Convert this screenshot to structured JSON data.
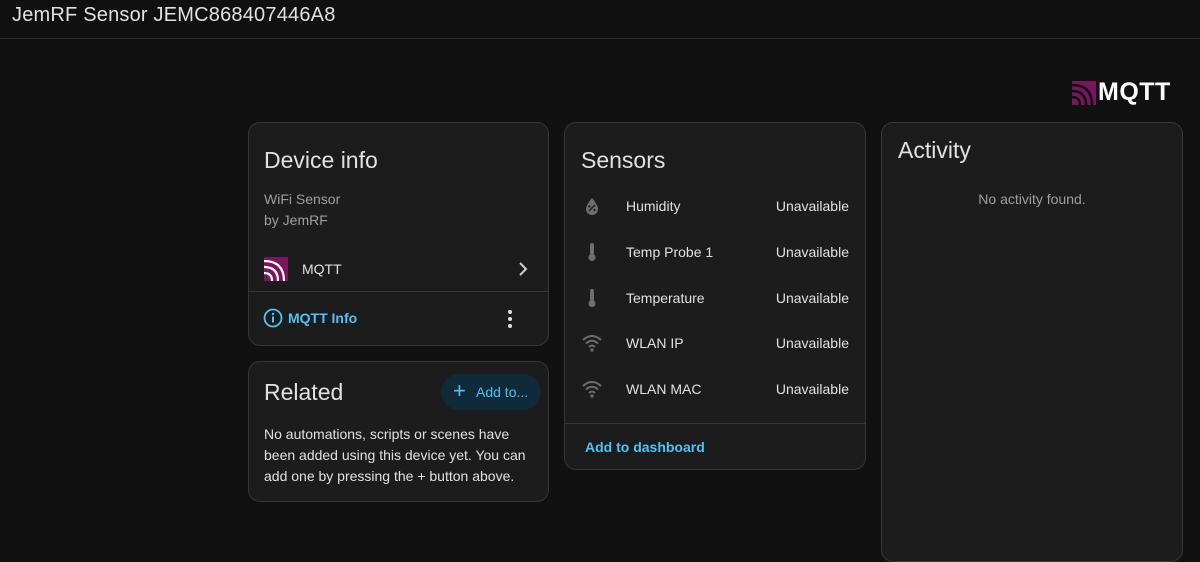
{
  "page": {
    "title": "JemRF Sensor JEMC868407446A8"
  },
  "brand": {
    "name": "MQTT",
    "accent": "#8c1a6a"
  },
  "device_info": {
    "heading": "Device info",
    "model": "WiFi Sensor",
    "manufacturer": "by JemRF",
    "integration": {
      "label": "MQTT",
      "icon": "mqtt-icon"
    },
    "action_label": "MQTT Info"
  },
  "related": {
    "heading": "Related",
    "add_label": "Add to...",
    "message": "No automations, scripts or scenes have been added using this device yet. You can add one by pressing the + button above."
  },
  "sensors": {
    "heading": "Sensors",
    "items": [
      {
        "name": "Humidity",
        "value": "Unavailable",
        "icon": "humidity-icon"
      },
      {
        "name": "Temp Probe 1",
        "value": "Unavailable",
        "icon": "thermometer-icon"
      },
      {
        "name": "Temperature",
        "value": "Unavailable",
        "icon": "thermometer-icon"
      },
      {
        "name": "WLAN IP",
        "value": "Unavailable",
        "icon": "wifi-icon"
      },
      {
        "name": "WLAN MAC",
        "value": "Unavailable",
        "icon": "wifi-icon"
      }
    ],
    "add_to_dashboard": "Add to dashboard"
  },
  "activity": {
    "heading": "Activity",
    "empty": "No activity found."
  },
  "colors": {
    "background": "#111111",
    "card": "#1c1c1c",
    "link": "#4fc3f7"
  }
}
